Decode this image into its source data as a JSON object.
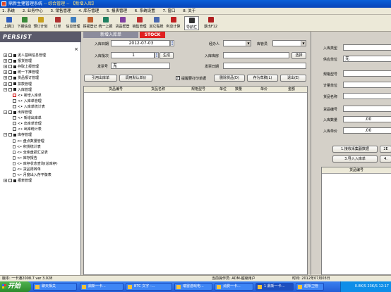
{
  "window": {
    "app_name": "鼎新生猪管理系统",
    "title_highlight": "-- 综合管理 -- 【新增入库】"
  },
  "menu": [
    "1. 系统",
    "2. 业务中心",
    "3. 销售管理",
    "4. 库存管理",
    "5. 报表管理",
    "6. 系统设置",
    "7. 窗口",
    "8. 关于"
  ],
  "toolbar": [
    {
      "label": "上期口",
      "icon": "window-icon",
      "color": "#2f5fbf"
    },
    {
      "label": "下期信息",
      "icon": "info-icon",
      "color": "#3a8a3a"
    },
    {
      "label": "预订计划",
      "icon": "plan-icon",
      "color": "#c8a020"
    },
    {
      "label": "订单",
      "icon": "order-icon",
      "color": "#b03030"
    },
    {
      "label": "信息管理",
      "icon": "info-mgmt-icon",
      "color": "#4080c0"
    },
    {
      "label": "探视登记",
      "icon": "register-icon",
      "color": "#c06030"
    },
    {
      "label": "统一上报",
      "icon": "report-icon",
      "color": "#208060"
    },
    {
      "label": "货品帮登",
      "icon": "goods-icon",
      "color": "#8040a0"
    },
    {
      "label": "销售管理",
      "icon": "sales-icon",
      "color": "#c03030"
    },
    {
      "label": "其它贴账",
      "icon": "ledger-icon",
      "color": "#4a6ab0"
    },
    {
      "label": "利息计算",
      "icon": "calc-icon",
      "color": "#c02020"
    },
    {
      "label": "导航栏",
      "icon": "nav-icon",
      "color": "#303030"
    },
    {
      "label": "退出F12",
      "icon": "exit-icon",
      "color": "#b02020"
    }
  ],
  "sidebar": {
    "brand": "PERSIST",
    "close": "×",
    "items": [
      {
        "label": "泥人基础信息管理",
        "level": 0,
        "exp": "+",
        "kind": "box"
      },
      {
        "label": "报货管理",
        "level": 0,
        "exp": "+",
        "kind": "box"
      },
      {
        "label": "存取上报管理",
        "level": 0,
        "exp": "+",
        "kind": "box"
      },
      {
        "label": "统一下推管理",
        "level": 0,
        "exp": "+",
        "kind": "box"
      },
      {
        "label": "货品报订管理",
        "level": 0,
        "exp": "+",
        "kind": "box"
      },
      {
        "label": "扣款管理",
        "level": 0,
        "exp": "+",
        "kind": "box"
      },
      {
        "label": "入库管理",
        "level": 0,
        "exp": "−",
        "kind": "box"
      },
      {
        "label": "新增入库单",
        "level": 1,
        "exp": "",
        "kind": "red"
      },
      {
        "label": "入库单管理",
        "level": 1,
        "exp": "",
        "kind": "box"
      },
      {
        "label": "入库单统计表",
        "level": 1,
        "exp": "",
        "kind": "box"
      },
      {
        "label": "出库管理",
        "level": 0,
        "exp": "−",
        "kind": "box"
      },
      {
        "label": "新增出库单",
        "level": 1,
        "exp": "",
        "kind": "box"
      },
      {
        "label": "出库单管理",
        "level": 1,
        "exp": "",
        "kind": "box"
      },
      {
        "label": "出库统计表",
        "level": 1,
        "exp": "",
        "kind": "box"
      },
      {
        "label": "库存管理",
        "level": 0,
        "exp": "−",
        "kind": "box"
      },
      {
        "label": "盘点数量管理",
        "level": 1,
        "exp": "",
        "kind": "doc"
      },
      {
        "label": "积货统计表",
        "level": 1,
        "exp": "",
        "kind": "doc"
      },
      {
        "label": "全库盘损汇总表",
        "level": 1,
        "exp": "",
        "kind": "doc"
      },
      {
        "label": "库存报告",
        "level": 1,
        "exp": "",
        "kind": "doc"
      },
      {
        "label": "库存状态查询(总库存)",
        "level": 1,
        "exp": "",
        "kind": "doc"
      },
      {
        "label": "货品周转单",
        "level": 1,
        "exp": "",
        "kind": "doc"
      },
      {
        "label": "月度出入存平衡表",
        "level": 1,
        "exp": "",
        "kind": "doc"
      },
      {
        "label": "报表管理",
        "level": 0,
        "exp": "+",
        "kind": "box"
      }
    ]
  },
  "main": {
    "tab_title": "新增入库单",
    "stock_badge": "STOCK",
    "form": {
      "in_date_label": "入库日期",
      "in_date_value": "2012-07-03",
      "handler_label": "经办人",
      "handler_value": "",
      "keeper_label": "库管员",
      "keeper_value": "",
      "in_seq_label": "入库批次",
      "in_seq_value": "1",
      "generate_btn": "生成",
      "warehouse_label": "入库库房",
      "warehouse_value": "",
      "select_btn": "选择",
      "doc_no_label": "发票号",
      "doc_no_value": "无",
      "issue_date_label": "发票日期",
      "issue_date_value": ""
    },
    "actions": {
      "ref_in": "引用出库单",
      "call_default": "调用默认单价",
      "print_check": "提醒要打印单据",
      "delete_row": "删除货品(D)",
      "save_draft": "存为草稿(L)",
      "exit": "退出(E)"
    },
    "grid_headers": [
      "货品编号",
      "货品名称",
      "规格型号",
      "单位",
      "数量",
      "单价",
      "金额"
    ]
  },
  "right": {
    "in_type_label": "入库类型",
    "supplier_label": "供应单位",
    "supplier_value": "无",
    "spec_label": "规格型号",
    "unit_label": "计量单位",
    "goods_name_label": "货品名称",
    "goods_no_label": "货品编号",
    "in_qty_label": "入库数量",
    "in_qty_value": ".00",
    "in_price_label": "入库单价",
    "in_price_value": ".00",
    "btn_scan": "1.接收采集器数据",
    "btn_scan2": "2E",
    "btn_import": "3.导入入库单",
    "btn_import2": "4.",
    "list_header": "货品编号"
  },
  "status": {
    "version": "版本: 一卡通2008.7 ver 3.028",
    "operator": "当前操作员: ADM-超级用户",
    "time": "时间: 2012年07月03日"
  },
  "taskbar": {
    "start": "开始",
    "tasks": [
      "聊天相关",
      "鼎新一卡...",
      "BTC 文字 -...",
      "瑞雷游戏电...",
      "消费一卡...",
      "1 鼎新一卡...",
      "超阳卫管"
    ],
    "tray_speed": "0.8K/S",
    "tray_speed2": "23K/S",
    "clock": "12:17"
  }
}
